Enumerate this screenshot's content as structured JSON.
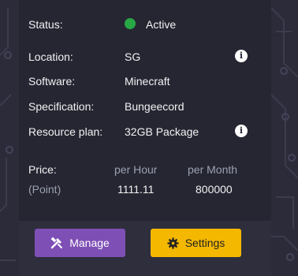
{
  "status": {
    "label": "Status:",
    "value": "Active",
    "color": "#28a745"
  },
  "details": [
    {
      "label": "Location:",
      "value": "SG",
      "info": true
    },
    {
      "label": "Software:",
      "value": "Minecraft",
      "info": false
    },
    {
      "label": "Specification:",
      "value": "Bungeecord",
      "info": false
    },
    {
      "label": "Resource plan:",
      "value": "32GB Package",
      "info": true
    }
  ],
  "price": {
    "label": "Price:",
    "unit_label": "(Point)",
    "per_hour_label": "per Hour",
    "per_month_label": "per Month",
    "per_hour_value": "1111.11",
    "per_month_value": "800000"
  },
  "buttons": {
    "manage": {
      "label": "Manage",
      "icon": "tools-icon"
    },
    "settings": {
      "label": "Settings",
      "icon": "gear-icon"
    }
  }
}
